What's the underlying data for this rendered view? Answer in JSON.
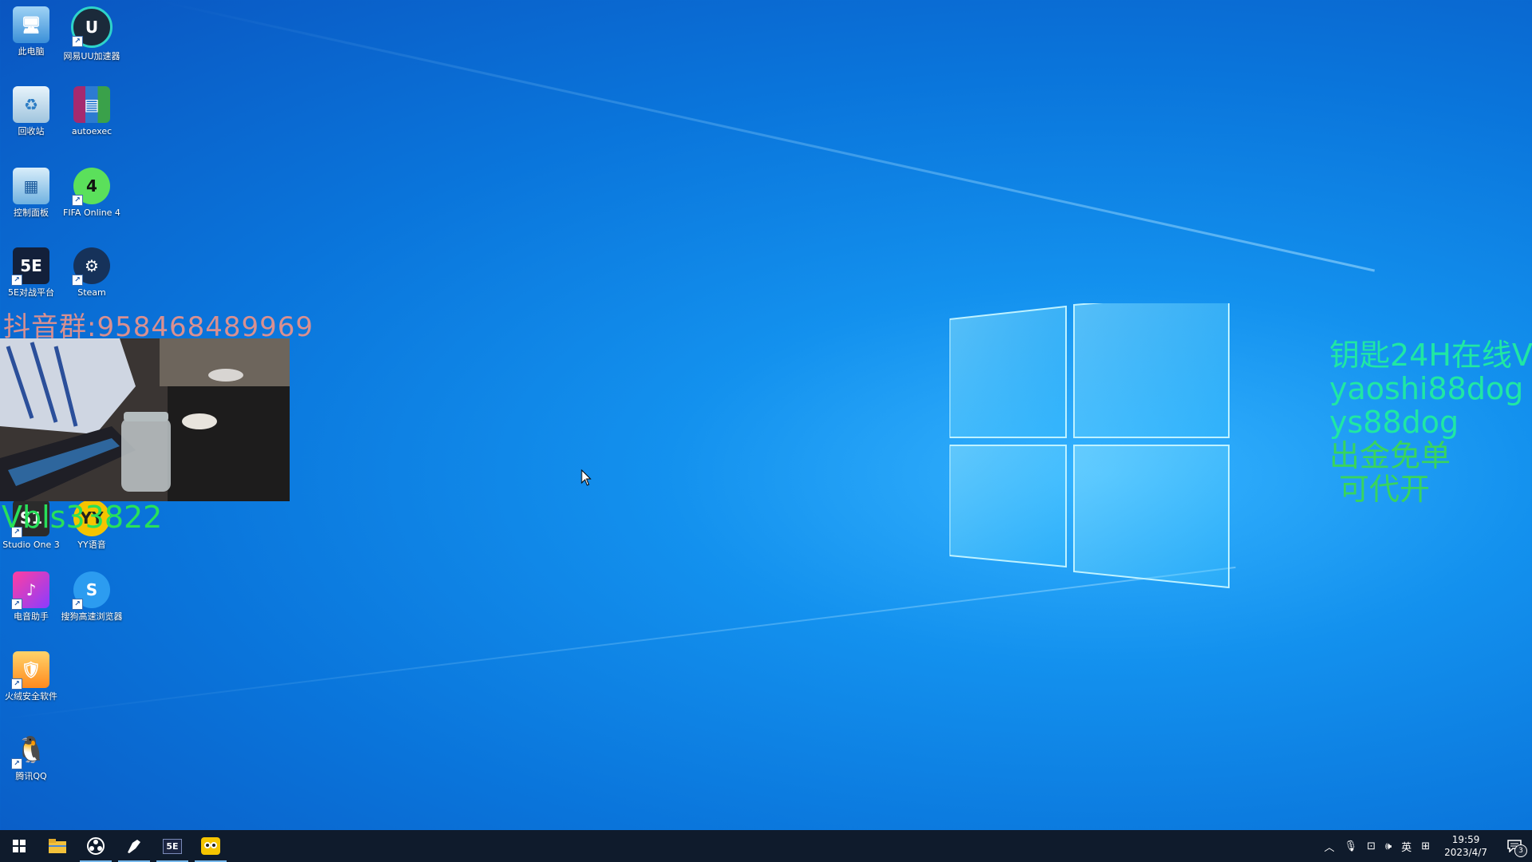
{
  "desktop": {
    "icons": [
      {
        "label": "此电脑",
        "icon": "computer-icon"
      },
      {
        "label": "网易UU加速器",
        "icon": "uu-accelerator-icon"
      },
      {
        "label": "回收站",
        "icon": "recycle-bin-icon"
      },
      {
        "label": "autoexec",
        "icon": "winrar-archive-icon"
      },
      {
        "label": "控制面板",
        "icon": "control-panel-icon"
      },
      {
        "label": "FIFA Online 4",
        "icon": "fifa-online-icon"
      },
      {
        "label": "5E对战平台",
        "icon": "5e-platform-icon"
      },
      {
        "label": "Steam",
        "icon": "steam-icon"
      },
      {
        "label": "Studio One 3",
        "icon": "studio-one-icon"
      },
      {
        "label": "YY语音",
        "icon": "yy-voice-icon"
      },
      {
        "label": "电音助手",
        "icon": "music-assistant-icon"
      },
      {
        "label": "搜狗高速浏览器",
        "icon": "sogou-browser-icon"
      },
      {
        "label": "火绒安全软件",
        "icon": "huorong-security-icon"
      },
      {
        "label": "腾讯QQ",
        "icon": "qq-penguin-icon"
      }
    ]
  },
  "overlays": {
    "douyin": "抖音群:958468489969",
    "vx": "Vbls33822",
    "promo": [
      "钥匙24H在线V",
      "yaoshi88dog",
      "ys88dog",
      "出金免单",
      "可代开"
    ]
  },
  "taskbar": {
    "apps": [
      {
        "icon": "windows-start-icon"
      },
      {
        "icon": "file-explorer-icon"
      },
      {
        "icon": "obs-icon"
      },
      {
        "icon": "pen-tool-icon"
      },
      {
        "icon": "5e-taskbar-icon",
        "label": "5E"
      },
      {
        "icon": "yy-taskbar-icon"
      }
    ],
    "tray": {
      "ime": "英",
      "time": "19:59",
      "date": "2023/4/7",
      "notifications": "3"
    }
  },
  "colors": {
    "accent": "#76b9ed",
    "promo_green": "#20e7a4",
    "vx_green": "#28e05a",
    "douyin_red": "#d99090"
  }
}
